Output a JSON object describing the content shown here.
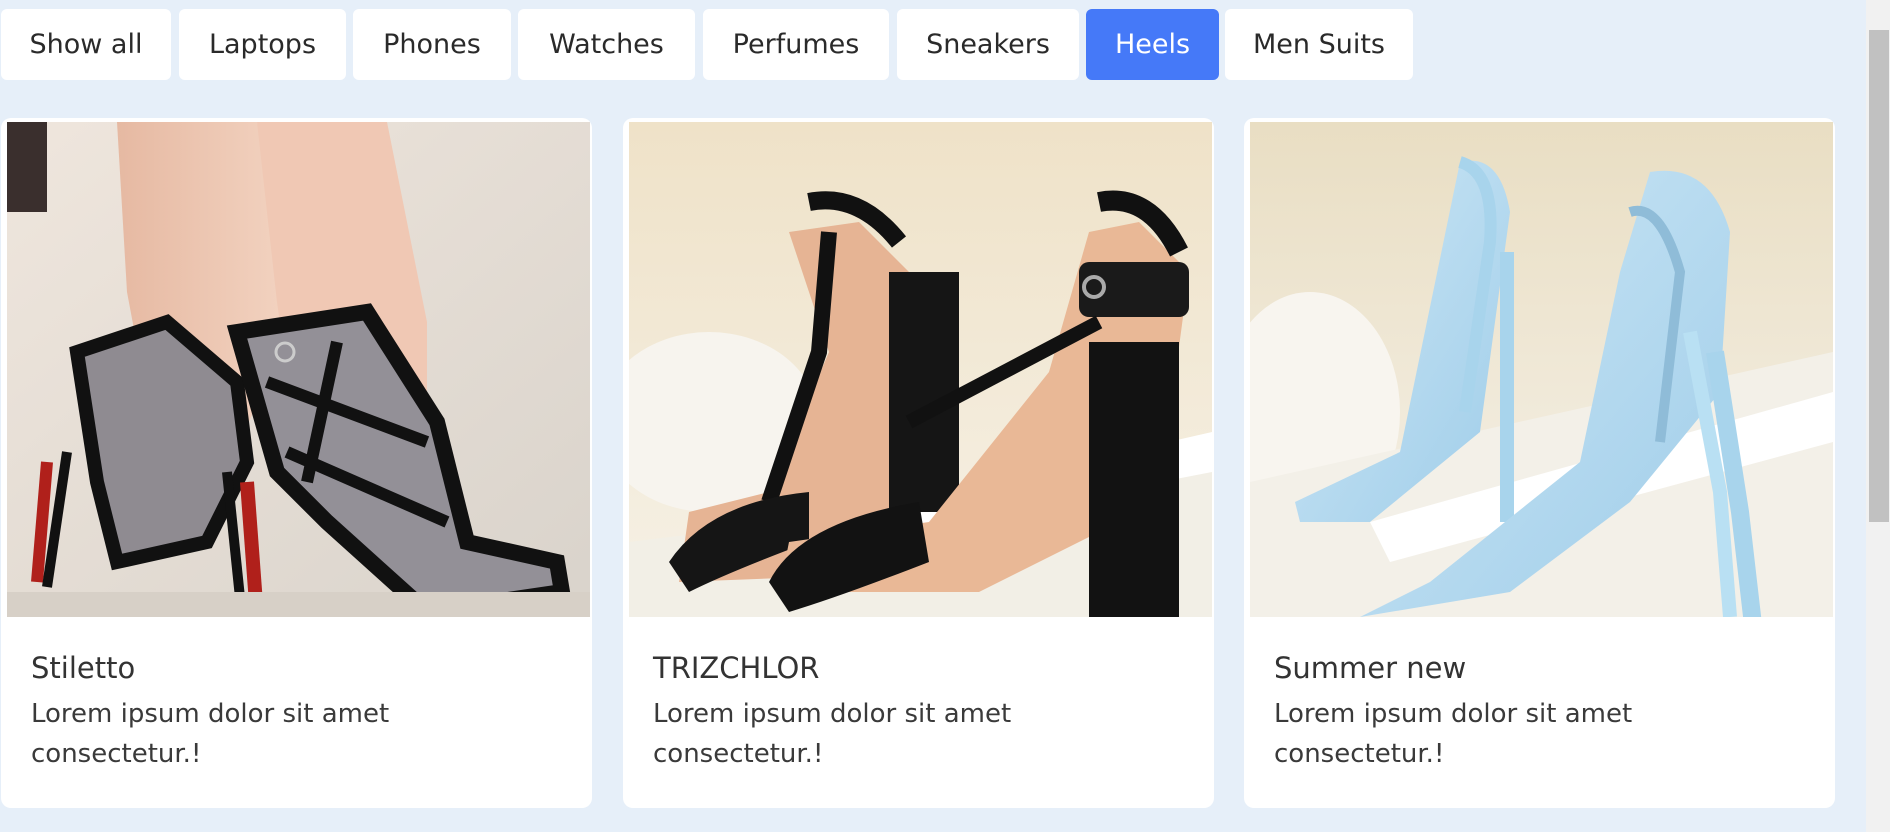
{
  "filters": {
    "items": [
      {
        "label": "Show all",
        "active": false
      },
      {
        "label": "Laptops",
        "active": false
      },
      {
        "label": "Phones",
        "active": false
      },
      {
        "label": "Watches",
        "active": false
      },
      {
        "label": "Perfumes",
        "active": false
      },
      {
        "label": "Sneakers",
        "active": false
      },
      {
        "label": "Heels",
        "active": true
      },
      {
        "label": "Men Suits",
        "active": false
      }
    ],
    "active_color": "#4579f8"
  },
  "products": [
    {
      "title": "Stiletto",
      "description": "Lorem ipsum dolor sit amet consectetur.!",
      "image": "black-strappy-heels-photo"
    },
    {
      "title": "TRIZCHLOR",
      "description": "Lorem ipsum dolor sit amet consectetur.!",
      "image": "black-block-heels-photo"
    },
    {
      "title": "Summer new",
      "description": "Lorem ipsum dolor sit amet consectetur.!",
      "image": "light-blue-pump-heels-photo"
    }
  ],
  "colors": {
    "background": "#e6eff9",
    "card": "#ffffff"
  }
}
